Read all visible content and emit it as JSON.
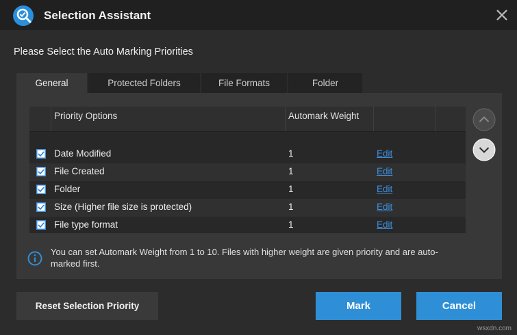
{
  "window": {
    "title": "Selection Assistant"
  },
  "heading": "Please Select the Auto Marking Priorities",
  "tabs": [
    {
      "label": "General",
      "active": true
    },
    {
      "label": "Protected Folders",
      "active": false
    },
    {
      "label": "File Formats",
      "active": false
    },
    {
      "label": "Folder",
      "active": false
    }
  ],
  "grid": {
    "columns": {
      "priority_options": "Priority Options",
      "automark_weight": "Automark Weight"
    },
    "rows": [
      {
        "checked": true,
        "option": "Date Modified",
        "weight": "1",
        "action": "Edit"
      },
      {
        "checked": true,
        "option": "File Created",
        "weight": "1",
        "action": "Edit"
      },
      {
        "checked": true,
        "option": "Folder",
        "weight": "1",
        "action": "Edit"
      },
      {
        "checked": true,
        "option": "Size (Higher file size is protected)",
        "weight": "1",
        "action": "Edit"
      },
      {
        "checked": true,
        "option": "File type format",
        "weight": "1",
        "action": "Edit"
      }
    ]
  },
  "info": {
    "text": "You can set Automark Weight from 1 to 10. Files with higher weight are given priority and are auto-marked first."
  },
  "buttons": {
    "reset": "Reset Selection Priority",
    "mark": "Mark",
    "cancel": "Cancel"
  },
  "watermark": "wsxdn.com",
  "colors": {
    "accent": "#2f8fd6",
    "link": "#3d8fe0",
    "background": "#2c2c2c",
    "titlebar": "#202020"
  },
  "icons": {
    "app": "magnifier-app-icon",
    "close": "close-icon",
    "move_up": "chevron-up-icon",
    "move_down": "chevron-down-icon",
    "info": "info-icon",
    "checkbox": "checkbox-checked-icon"
  }
}
